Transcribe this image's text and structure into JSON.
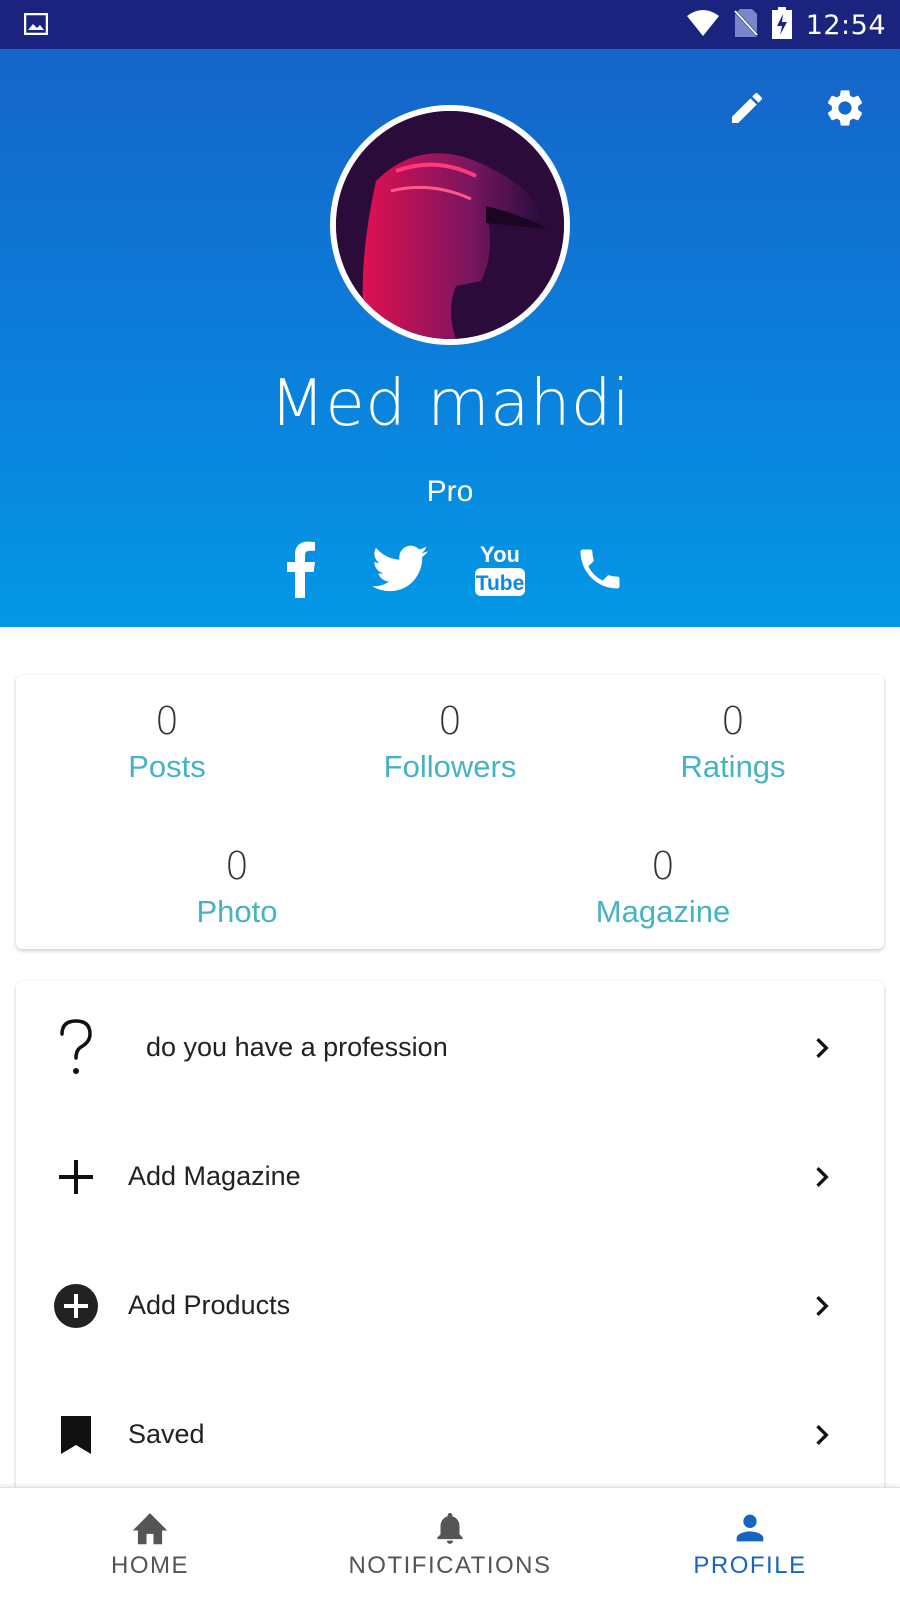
{
  "status_bar": {
    "time": "12:54"
  },
  "profile": {
    "name": "Med mahdi",
    "role": "Pro"
  },
  "socials": [
    {
      "name": "facebook-icon"
    },
    {
      "name": "twitter-icon"
    },
    {
      "name": "youtube-icon",
      "text_top": "You",
      "text_bottom": "Tube"
    },
    {
      "name": "phone-icon"
    }
  ],
  "stats": {
    "posts": {
      "value": "0",
      "label": "Posts"
    },
    "followers": {
      "value": "0",
      "label": "Followers"
    },
    "ratings": {
      "value": "0",
      "label": "Ratings"
    },
    "photo": {
      "value": "0",
      "label": "Photo"
    },
    "magazine": {
      "value": "0",
      "label": "Magazine"
    }
  },
  "menu": {
    "profession": "do you have a profession",
    "add_magazine": "Add Magazine",
    "add_products": "Add Products",
    "saved": "Saved"
  },
  "bottom_nav": {
    "home": "HOME",
    "notifications": "NOTIFICATIONS",
    "profile": "PROFILE"
  },
  "colors": {
    "status_bar": "#1a237e",
    "header_top": "#1565c8",
    "header_bottom": "#0398e6",
    "stat_label": "#46b3c4",
    "active_nav": "#1565c0"
  }
}
